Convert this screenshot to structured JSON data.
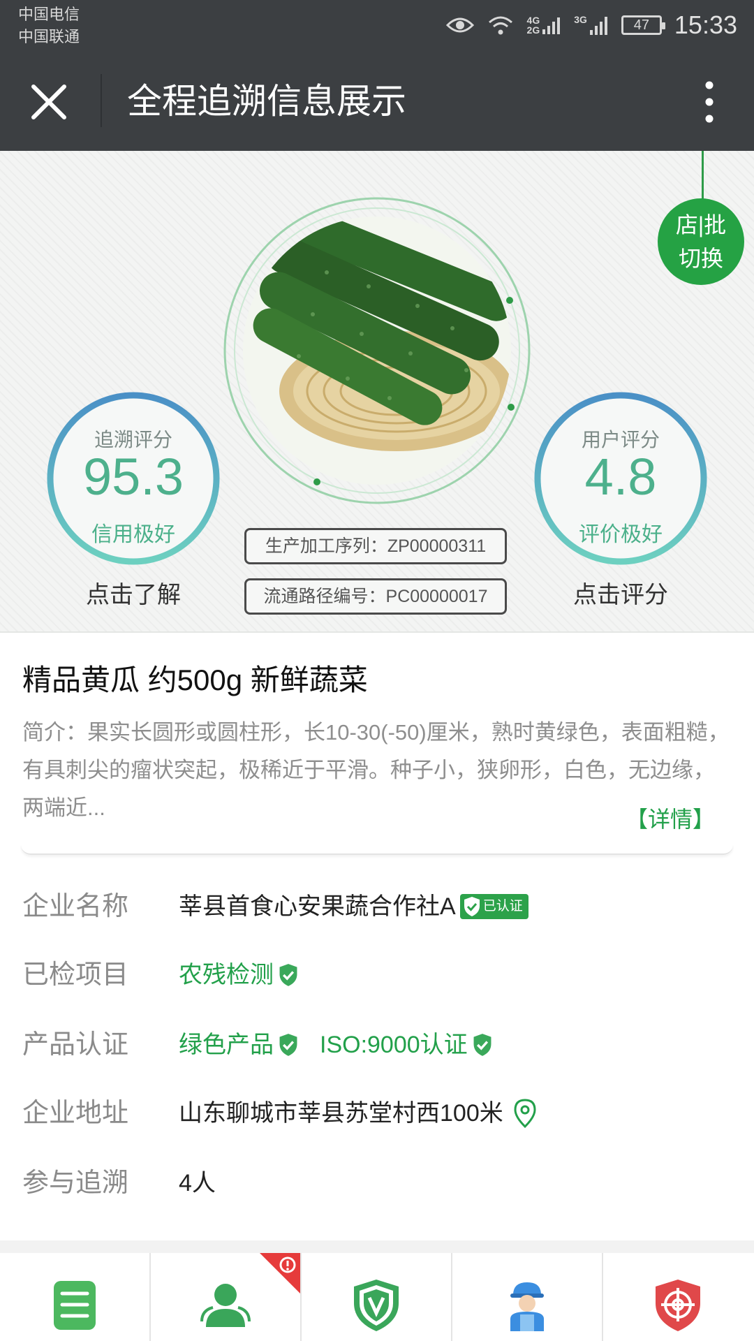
{
  "status_bar": {
    "carrier_1": "中国电信",
    "carrier_2": "中国联通",
    "net_4g": "4G",
    "net_2g": "2G",
    "net_3g": "3G",
    "battery": "47",
    "time": "15:33"
  },
  "nav": {
    "title": "全程追溯信息展示"
  },
  "hero": {
    "switch_button": [
      "店|批",
      "切换"
    ],
    "trace_score": {
      "caption": "追溯评分",
      "value": "95.3",
      "desc": "信用极好",
      "link": "点击了解"
    },
    "user_score": {
      "caption": "用户评分",
      "value": "4.8",
      "desc": "评价极好",
      "link": "点击评分"
    },
    "production_code": "生产加工序列：ZP00000311",
    "circulation_code": "流通路径编号：PC00000017"
  },
  "product": {
    "title": "精品黄瓜 约500g 新鲜蔬菜",
    "intro": "简介：果实长圆形或圆柱形，长10-30(-50)厘米，熟时黄绿色，表面粗糙，有具刺尖的瘤状突起，极稀近于平滑。种子小，狭卵形，白色，无边缘，两端近...",
    "detail_link": "【详情】"
  },
  "info": {
    "company": {
      "label": "企业名称",
      "value": "莘县首食心安果蔬合作社A",
      "badge": "已认证"
    },
    "inspected": {
      "label": "已检项目",
      "value": "农残检测"
    },
    "certification": {
      "label": "产品认证",
      "value_1": "绿色产品",
      "value_2": "ISO:9000认证"
    },
    "address": {
      "label": "企业地址",
      "value": "山东聊城市莘县苏堂村西100米"
    },
    "participants": {
      "label": "参与追溯",
      "value": "4人"
    }
  },
  "tabs": [
    "document-icon",
    "person-icon",
    "shield-v-icon",
    "worker-icon",
    "target-icon"
  ],
  "colors": {
    "bar": "#3c3f42",
    "green": "#22a04a",
    "score_text": "#4db08c",
    "alert_red": "#e63b3b"
  }
}
